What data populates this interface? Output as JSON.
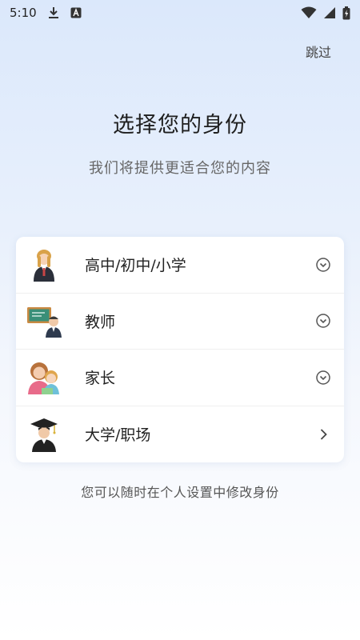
{
  "status_bar": {
    "time": "5:10",
    "icons": [
      "download-icon",
      "app-icon",
      "wifi-icon",
      "battery-icon"
    ]
  },
  "header": {
    "skip_label": "跳过",
    "title": "选择您的身份",
    "subtitle": "我们将提供更适合您的内容"
  },
  "roles": [
    {
      "label": "高中/初中/小学",
      "icon": "student-avatar-icon",
      "indicator": "chevron-down-circle-icon"
    },
    {
      "label": "教师",
      "icon": "teacher-avatar-icon",
      "indicator": "chevron-down-circle-icon"
    },
    {
      "label": "家长",
      "icon": "parent-avatar-icon",
      "indicator": "chevron-down-circle-icon"
    },
    {
      "label": "大学/职场",
      "icon": "graduate-avatar-icon",
      "indicator": "chevron-right-icon"
    }
  ],
  "footer_note": "您可以随时在个人设置中修改身份",
  "colors": {
    "background_top": "#dbe8fb",
    "background_bottom": "#ffffff",
    "card": "#ffffff",
    "text_primary": "#222222",
    "text_secondary": "#666666"
  }
}
